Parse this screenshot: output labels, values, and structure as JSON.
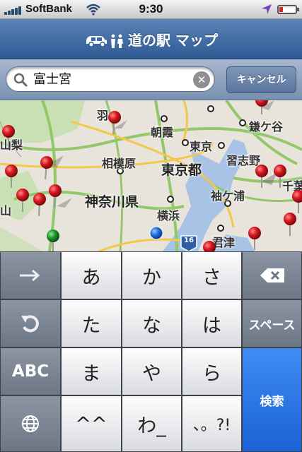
{
  "status": {
    "carrier": "SoftBank",
    "time": "9:30",
    "wifi_icon": "wifi-icon",
    "location_icon": "location-arrow-icon",
    "battery_icon": "battery-low-icon"
  },
  "nav": {
    "title": "道の駅 マップ",
    "icon": "car-restroom-icon"
  },
  "search": {
    "value": "富士宮",
    "icon": "search-icon",
    "clear_icon": "clear-icon",
    "cancel_label": "キャンセル"
  },
  "map": {
    "labels": [
      {
        "id": "hane",
        "text": "羽"
      },
      {
        "id": "asaka",
        "text": "朝霞"
      },
      {
        "id": "kamagaya",
        "text": "鎌ケ谷"
      },
      {
        "id": "yamanashi",
        "text": "山梨"
      },
      {
        "id": "sagamihara",
        "text": "相模原"
      },
      {
        "id": "tokyo",
        "text": "東京"
      },
      {
        "id": "narashino",
        "text": "習志野"
      },
      {
        "id": "tokyoto",
        "text": "東京都"
      },
      {
        "id": "chiba",
        "text": "千葉"
      },
      {
        "id": "sodegaura",
        "text": "袖ケ浦"
      },
      {
        "id": "kanagawa",
        "text": "神奈川県"
      },
      {
        "id": "yokohama",
        "text": "横浜"
      },
      {
        "id": "sanyama",
        "text": "山"
      },
      {
        "id": "kimitsu",
        "text": "君津"
      },
      {
        "id": "route",
        "text": "16"
      }
    ],
    "colors": {
      "red_pin": "#d9171e",
      "green_pin": "#1e9a2c",
      "blue_dot": "#1f6fe0",
      "water": "#a9c3e6",
      "land": "#e8e4dc",
      "park": "#c9dfb4",
      "highway": "#f3c84a",
      "road": "#93c86a"
    }
  },
  "keyboard": {
    "rows": [
      {
        "left_icon": "arrow-right-icon",
        "keys": [
          "あ",
          "か",
          "さ"
        ],
        "right_icon": "backspace-icon"
      },
      {
        "left_icon": "undo-icon",
        "keys": [
          "た",
          "な",
          "は"
        ],
        "right_label": "スペース"
      },
      {
        "left_label": "ABC",
        "keys": [
          "ま",
          "や",
          "ら"
        ]
      },
      {
        "left_icon": "globe-icon",
        "keys": [
          "^^",
          "わ_",
          "、。?!"
        ]
      }
    ],
    "search_label": "検索"
  }
}
